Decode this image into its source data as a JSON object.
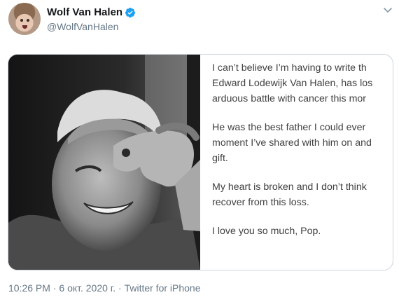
{
  "author": {
    "name": "Wolf Van Halen",
    "handle": "@WolfVanHalen",
    "avatar_icon": "avatar-portrait",
    "verified_icon": "verified-badge-icon",
    "verified_color": "#1da1f2"
  },
  "caret_icon": "chevron-down-icon",
  "statement": {
    "paragraphs": [
      [
        "I can’t believe I’m having to write th",
        "Edward Lodewijk Van Halen, has los",
        "arduous battle with cancer this mor"
      ],
      [
        "He was the best father I could ever",
        "moment I’ve shared with him on and",
        "gift."
      ],
      [
        "My heart is broken and I don’t think",
        "recover from this loss."
      ],
      [
        "I love you so much, Pop."
      ]
    ]
  },
  "meta": {
    "time": "10:26 PM",
    "date": "6 окт. 2020 г.",
    "separator": "·",
    "source": "Twitter for iPhone"
  }
}
